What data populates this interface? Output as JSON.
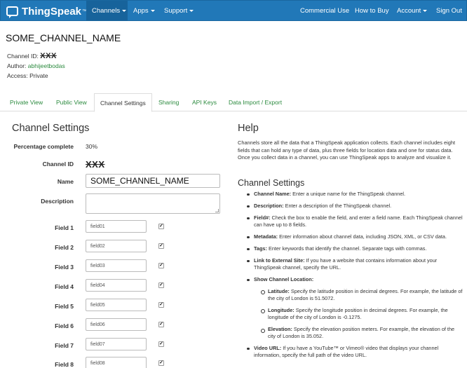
{
  "navbar": {
    "brand": "ThingSpeak",
    "brand_tm": "™",
    "menu": [
      {
        "label": "Channels",
        "dropdown": true,
        "active": true
      },
      {
        "label": "Apps",
        "dropdown": true
      },
      {
        "label": "Support",
        "dropdown": true
      }
    ],
    "right": [
      {
        "label": "Commercial Use"
      },
      {
        "label": "How to Buy"
      },
      {
        "label": "Account",
        "dropdown": true
      },
      {
        "label": "Sign Out"
      }
    ],
    "colors": {
      "bar": "#2178b8",
      "active": "#17639b"
    }
  },
  "channel": {
    "name": "SOME_CHANNEL_NAME",
    "id_label": "Channel ID:",
    "id_value": "XXX",
    "author_label": "Author:",
    "author_value": "abhijeetbodas",
    "access_label": "Access:",
    "access_value": "Private"
  },
  "tabs": [
    {
      "label": "Private View"
    },
    {
      "label": "Public View"
    },
    {
      "label": "Channel Settings",
      "active": true
    },
    {
      "label": "Sharing"
    },
    {
      "label": "API Keys"
    },
    {
      "label": "Data Import / Export"
    }
  ],
  "settings": {
    "title": "Channel Settings",
    "percentage_label": "Percentage complete",
    "percentage_value": "30%",
    "channel_id_label": "Channel ID",
    "channel_id_value": "XXX",
    "name_label": "Name",
    "name_value": "SOME_CHANNEL_NAME",
    "description_label": "Description",
    "description_value": "",
    "fields": [
      {
        "label": "Field 1",
        "value": "field01",
        "checked": true
      },
      {
        "label": "Field 2",
        "value": "field02",
        "checked": true
      },
      {
        "label": "Field 3",
        "value": "field03",
        "checked": true
      },
      {
        "label": "Field 4",
        "value": "field04",
        "checked": true
      },
      {
        "label": "Field 5",
        "value": "field05",
        "checked": true
      },
      {
        "label": "Field 6",
        "value": "field06",
        "checked": true
      },
      {
        "label": "Field 7",
        "value": "field07",
        "checked": true
      },
      {
        "label": "Field 8",
        "value": "field08",
        "checked": true
      }
    ],
    "check_mark": "✓"
  },
  "help": {
    "title": "Help",
    "intro": "Channels store all the data that a ThingSpeak application collects. Each channel includes eight fields that can hold any type of data, plus three fields for location data and one for status data. Once you collect data in a channel, you can use ThingSpeak apps to analyze and visualize it.",
    "subtitle": "Channel Settings",
    "items": [
      {
        "term": "Channel Name:",
        "text": " Enter a unique name for the ThingSpeak channel."
      },
      {
        "term": "Description:",
        "text": " Enter a description of the ThingSpeak channel."
      },
      {
        "term": "Field#:",
        "text": " Check the box to enable the field, and enter a field name. Each ThingSpeak channel can have up to 8 fields."
      },
      {
        "term": "Metadata:",
        "text": " Enter information about channel data, including JSON, XML, or CSV data."
      },
      {
        "term": "Tags:",
        "text": " Enter keywords that identify the channel. Separate tags with commas."
      },
      {
        "term": "Link to External Site:",
        "text": " If you have a website that contains information about your ThingSpeak channel, specify the URL."
      },
      {
        "term": "Show Channel Location:",
        "text": ""
      },
      {
        "term": "Video URL:",
        "text": " If you have a YouTube™ or Vimeo® video that displays your channel information, specify the full path of the video URL."
      }
    ],
    "location_items": [
      {
        "term": "Latitude:",
        "text": " Specify the latitude position in decimal degrees. For example, the latitude of the city of London is 51.5072."
      },
      {
        "term": "Longitude:",
        "text": " Specify the longitude position in decimal degrees. For example, the longitude of the city of London is -0.1275."
      },
      {
        "term": "Elevation:",
        "text": " Specify the elevation position meters. For example, the elevation of the city of London is 35.052."
      }
    ]
  }
}
